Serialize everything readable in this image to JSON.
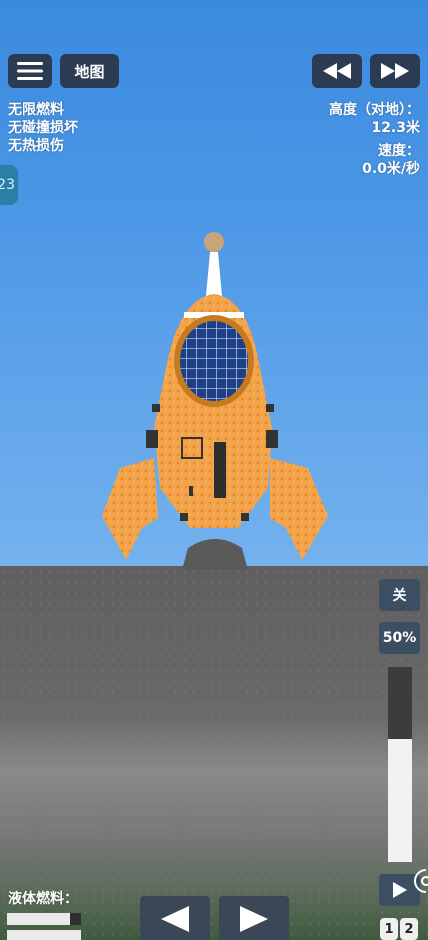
{
  "top_bar": {
    "map_label": "地图"
  },
  "status": {
    "line1": "无限燃料",
    "line2": "无碰撞损坏",
    "line3": "无热损伤"
  },
  "stage_badge": "23",
  "readouts": {
    "altitude_label": "高度（对地）：",
    "altitude_value": "12.3米",
    "speed_label": "速度：",
    "speed_value": "0.0米/秒"
  },
  "controls": {
    "toggle_label": "关",
    "throttle_label": "50%",
    "throttle_fraction": 0.63,
    "fuel_label": "液体燃料：",
    "fuel_fractions": [
      0.85,
      1.0
    ],
    "page_1": "1",
    "page_2": "2"
  },
  "colors": {
    "button_bg": "#2b3b52",
    "rocket_orange": "#f0a040",
    "window_blue": "#1f4fa0"
  },
  "icons": [
    "menu-icon",
    "rewind-icon",
    "fast-forward-icon",
    "arrow-left-icon",
    "arrow-right-icon",
    "play-icon",
    "screenshot-icon"
  ]
}
